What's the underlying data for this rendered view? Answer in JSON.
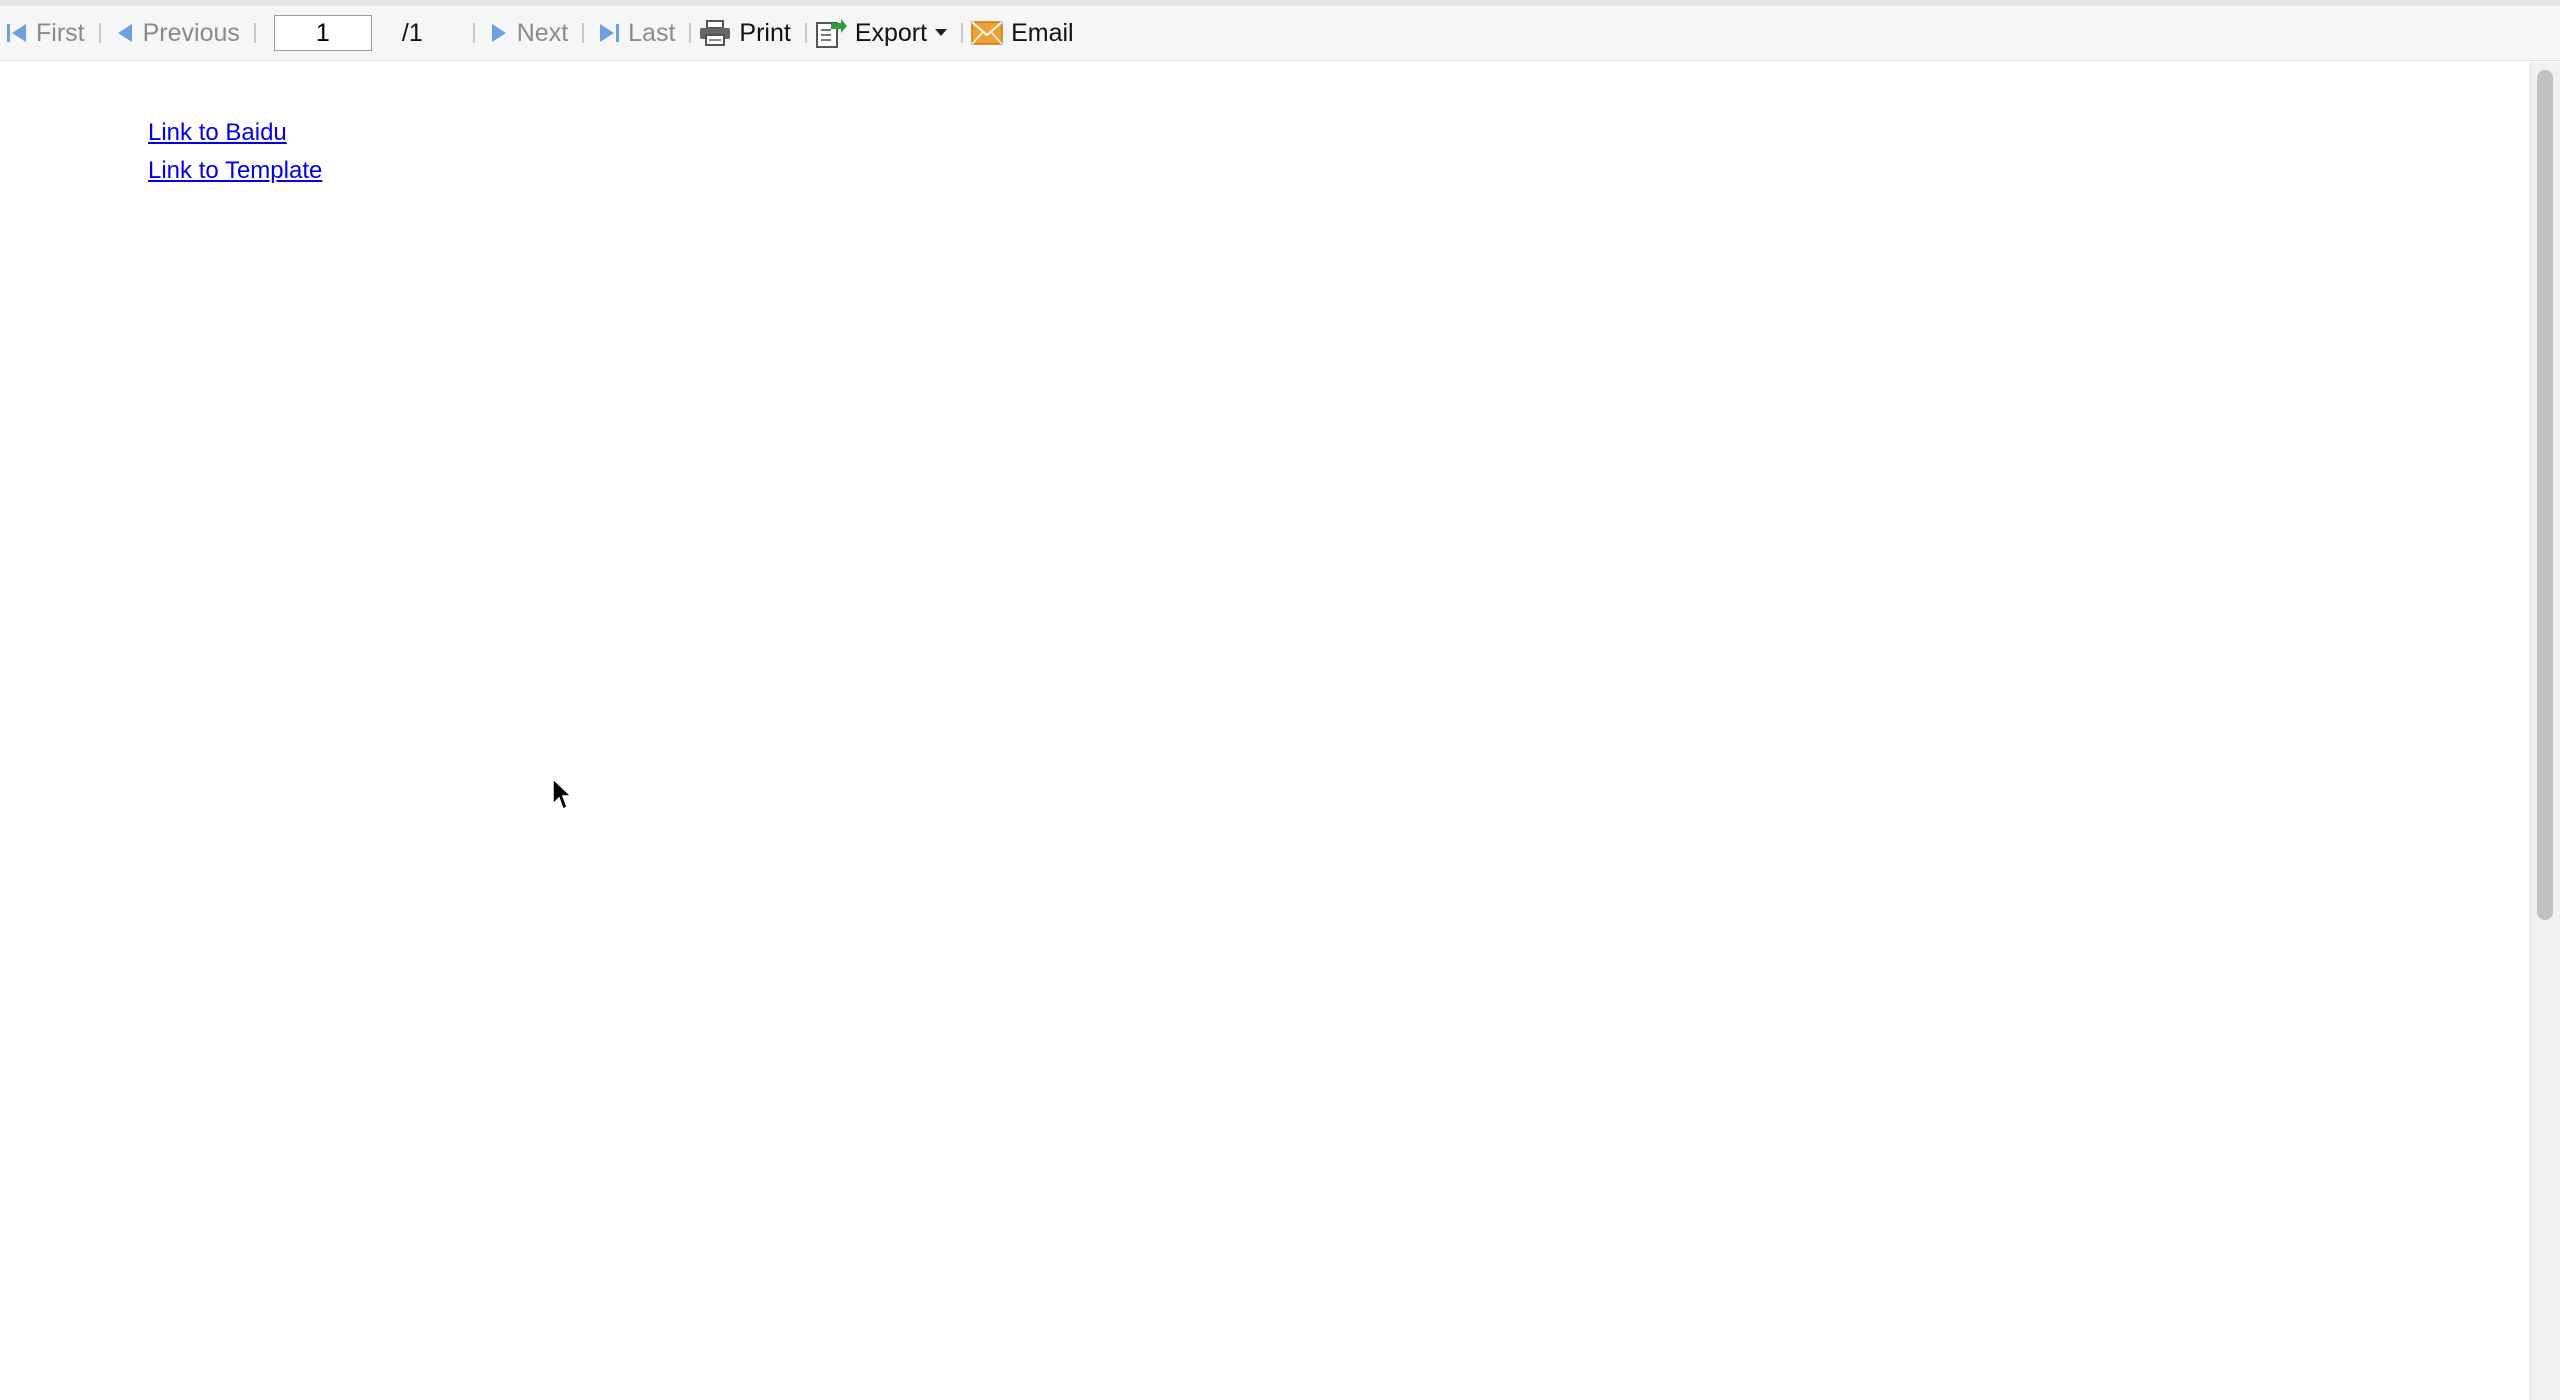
{
  "toolbar": {
    "first_label": "First",
    "previous_label": "Previous",
    "page_input_value": "1",
    "page_total": "/1",
    "next_label": "Next",
    "last_label": "Last",
    "print_label": "Print",
    "export_label": "Export",
    "email_label": "Email"
  },
  "links": [
    {
      "label": "Link to Baidu"
    },
    {
      "label": "Link to Template"
    }
  ],
  "colors": {
    "link": "#0000ee",
    "nav_icon": "#6f9fe0",
    "export_icon": "#2e9d3f",
    "email_icon": "#f0a030"
  },
  "icons": {
    "first": "first-page-icon",
    "previous": "previous-page-icon",
    "next": "next-page-icon",
    "last": "last-page-icon",
    "print": "printer-icon",
    "export": "export-icon",
    "export_dropdown": "caret-down-icon",
    "email": "envelope-icon"
  }
}
